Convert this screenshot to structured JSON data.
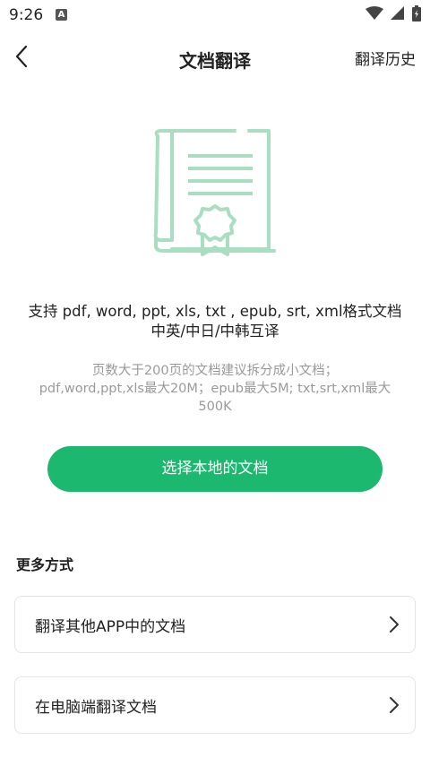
{
  "status_bar": {
    "time": "9:26",
    "notification_icon": "A"
  },
  "header": {
    "title": "文档翻译",
    "history_label": "翻译历史"
  },
  "main": {
    "support_line": "支持 pdf, word, ppt, xls, txt , epub, srt, xml格式文档中英/中日/中韩互译",
    "hint_line1": "页数大于200页的文档建议拆分成小文档；",
    "hint_line2": "pdf,word,ppt,xls最大20M；epub最大5M; txt,srt,xml最大500K",
    "select_button_label": "选择本地的文档"
  },
  "more": {
    "section_title": "更多方式",
    "options": [
      {
        "label": "翻译其他APP中的文档"
      },
      {
        "label": "在电脑端翻译文档"
      }
    ]
  },
  "colors": {
    "accent": "#1DB86F",
    "illustration": "#A8DFC2",
    "hint": "#9A9A9A"
  },
  "icons": [
    "back-arrow-icon",
    "document-certificate-icon",
    "chevron-right-icon",
    "wifi-icon",
    "signal-icon",
    "battery-icon"
  ]
}
